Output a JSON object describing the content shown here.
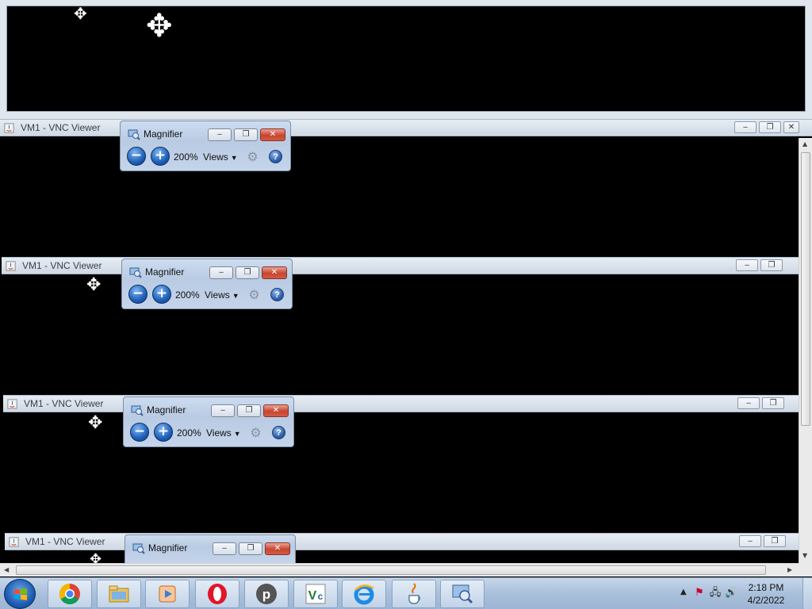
{
  "vnc_windows": [
    {
      "title": "VM1 - VNC Viewer"
    },
    {
      "title": "VM1 - VNC Viewer"
    },
    {
      "title": "VM1 - VNC Viewer"
    },
    {
      "title": "VM1 - VNC Viewer"
    }
  ],
  "magnifier": {
    "title": "Magnifier",
    "zoom": "200%",
    "views_label": "Views"
  },
  "window_controls": {
    "minimize": "‒",
    "restore": "❐",
    "close": "✕"
  },
  "taskbar": {
    "pinned": [
      "chrome-icon",
      "file-explorer-icon",
      "media-player-icon",
      "opera-icon",
      "psiphon-icon",
      "vnc-viewer-icon",
      "internet-explorer-icon",
      "java-icon",
      "magnifier-icon"
    ],
    "clock_time": "2:18 PM",
    "clock_date": "4/2/2022"
  },
  "colors": {
    "titlebar": "#dbe4ee",
    "magnifier_frame": "#c2d3ea",
    "taskbar": "#b3c8e0",
    "close_red": "#c8452f"
  }
}
